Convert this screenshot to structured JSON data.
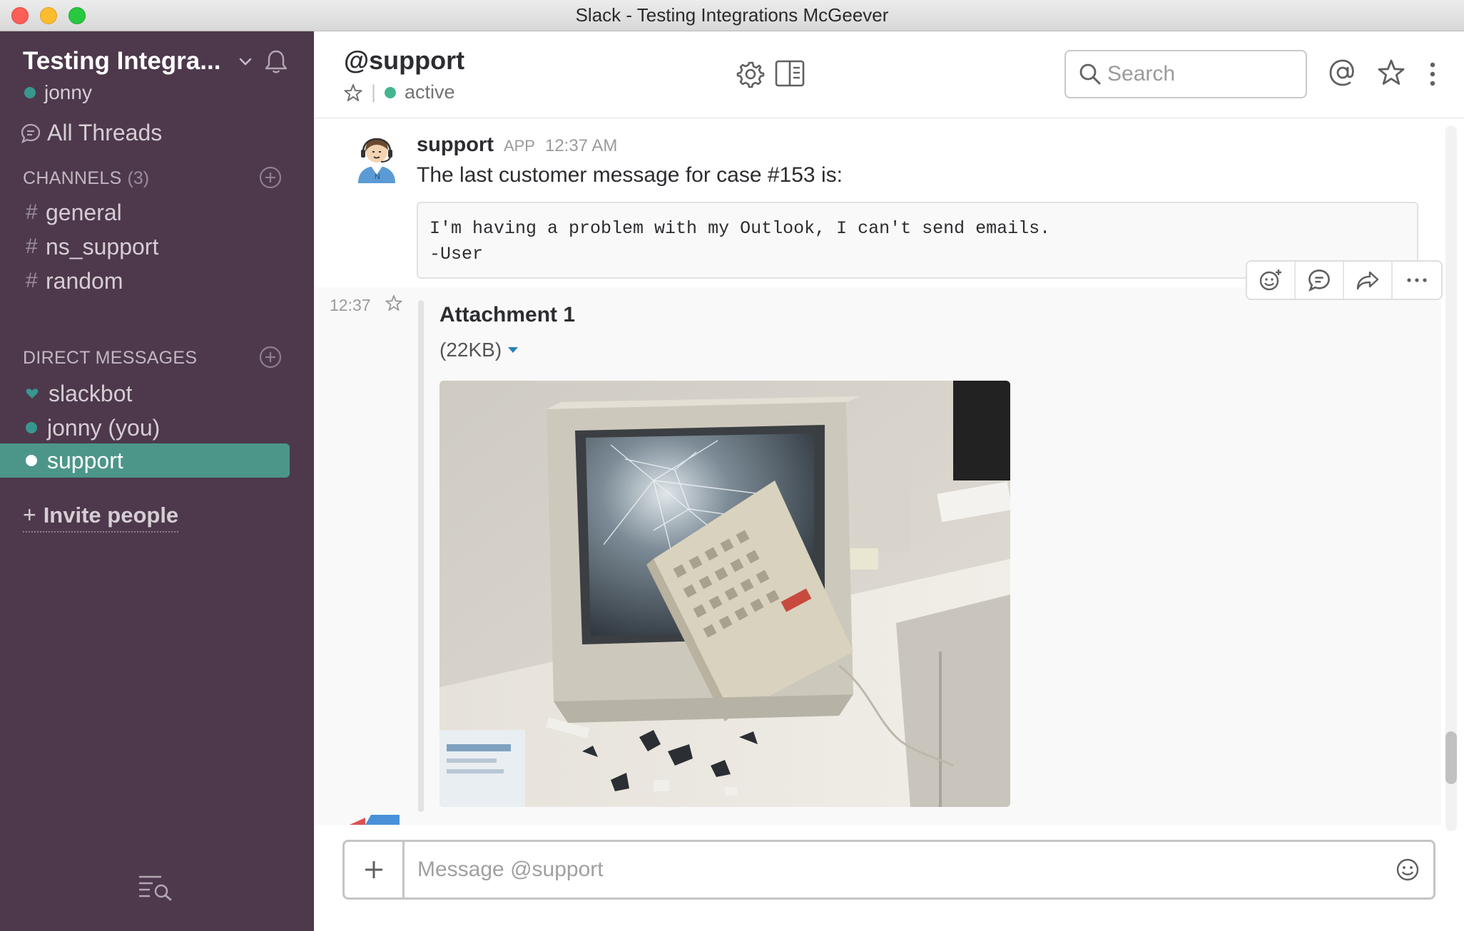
{
  "window": {
    "title": "Slack - Testing Integrations McGeever"
  },
  "sidebar": {
    "team_name": "Testing Integra...",
    "current_user": "jonny",
    "all_threads": "All Threads",
    "channels_header": "CHANNELS",
    "channels_count": "(3)",
    "channels": [
      "general",
      "ns_support",
      "random"
    ],
    "dm_header": "DIRECT MESSAGES",
    "dms": [
      "slackbot",
      "jonny (you)",
      "support"
    ],
    "active_dm": "support",
    "invite": "Invite people"
  },
  "header": {
    "channel_title": "@support",
    "status": "active",
    "search_placeholder": "Search"
  },
  "messages": [
    {
      "sender": "support",
      "badge": "APP",
      "time": "12:37 AM",
      "text": "The last customer message for case #153 is:",
      "code": "I'm having a problem with my Outlook, I can't send emails.\n-User"
    }
  ],
  "attachment": {
    "hover_time": "12:37",
    "title": "Attachment 1",
    "size": "(22KB)"
  },
  "composer": {
    "placeholder": "Message @support"
  },
  "colors": {
    "sidebar_bg": "#4d394b",
    "active_item": "#4c9689",
    "presence_green": "#44b58f",
    "link_blue": "#2a80b9"
  },
  "icons": [
    "bell-icon",
    "chevron-down-icon",
    "threads-icon",
    "add-channel-icon",
    "heart-icon",
    "quick-switcher-icon",
    "star-icon",
    "gear-icon",
    "sidebar-toggle-icon",
    "search-icon",
    "mention-icon",
    "more-vertical-icon",
    "add-reaction-icon",
    "thread-icon",
    "share-icon",
    "more-icon",
    "plus-icon",
    "emoji-icon"
  ]
}
